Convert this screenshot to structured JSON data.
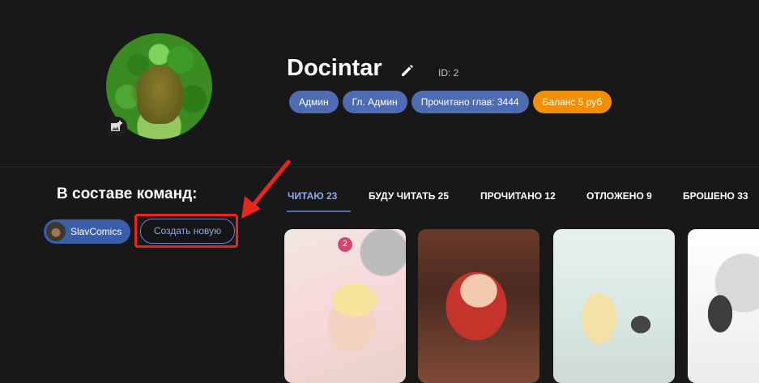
{
  "profile": {
    "username": "Docintar",
    "id_label": "ID: 2",
    "badges": [
      "Админ",
      "Гл. Админ",
      "Прочитано глав: 3444",
      "Баланс 5 руб"
    ],
    "balance_color": "#f08f08",
    "badge_color": "#4f6bb2"
  },
  "teams": {
    "title": "В составе команд:",
    "items": [
      "SlavComics"
    ],
    "create_label": "Создать новую"
  },
  "tabs": [
    {
      "label": "ЧИТАЮ 23",
      "active": true
    },
    {
      "label": "БУДУ ЧИТАТЬ 25"
    },
    {
      "label": "ПРОЧИТАНО 12"
    },
    {
      "label": "ОТЛОЖЕНО 9"
    },
    {
      "label": "БРОШЕНО 33"
    }
  ],
  "accent_color": "#8ea9ee",
  "annotation_color": "#e7271f",
  "icons": [
    "edit-pencil-icon",
    "add-photo-icon",
    "red-arrow-annotation"
  ]
}
